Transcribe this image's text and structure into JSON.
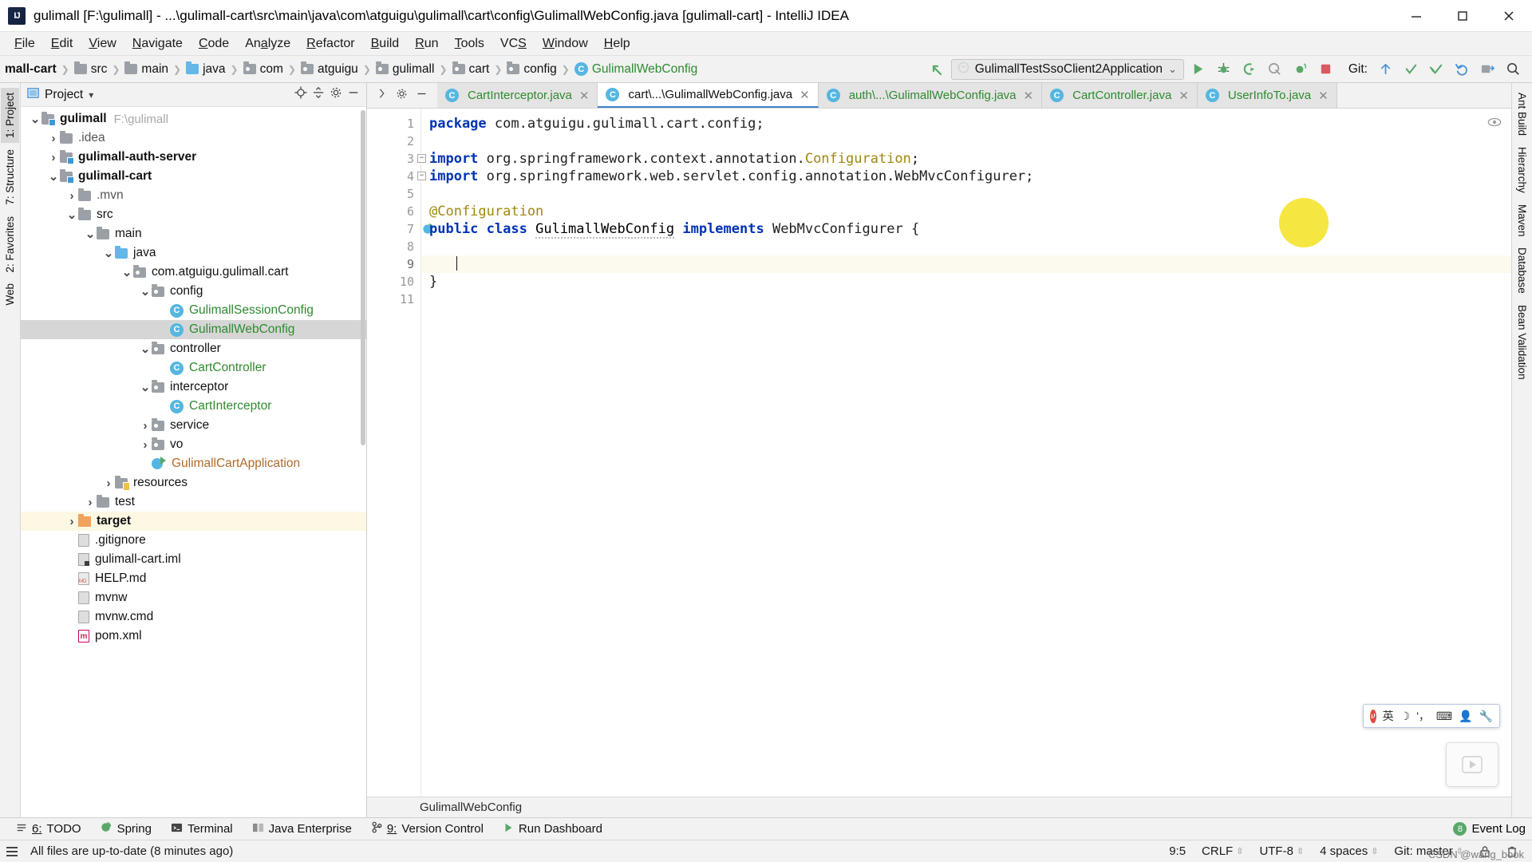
{
  "window": {
    "title": "gulimall [F:\\gulimall] - ...\\gulimall-cart\\src\\main\\java\\com\\atguigu\\gulimall\\cart\\config\\GulimallWebConfig.java [gulimall-cart] - IntelliJ IDEA",
    "logo_text": "IJ",
    "minimize": "–",
    "maximize": "□",
    "close": "✕"
  },
  "menubar": {
    "items": [
      {
        "pre": "",
        "mn": "F",
        "post": "ile"
      },
      {
        "pre": "",
        "mn": "E",
        "post": "dit"
      },
      {
        "pre": "",
        "mn": "V",
        "post": "iew"
      },
      {
        "pre": "",
        "mn": "N",
        "post": "avigate"
      },
      {
        "pre": "",
        "mn": "C",
        "post": "ode"
      },
      {
        "pre": "An",
        "mn": "a",
        "post": "lyze"
      },
      {
        "pre": "",
        "mn": "R",
        "post": "efactor"
      },
      {
        "pre": "",
        "mn": "B",
        "post": "uild"
      },
      {
        "pre": "",
        "mn": "R",
        "post": "un"
      },
      {
        "pre": "",
        "mn": "T",
        "post": "ools"
      },
      {
        "pre": "VC",
        "mn": "S",
        "post": ""
      },
      {
        "pre": "",
        "mn": "W",
        "post": "indow"
      },
      {
        "pre": "",
        "mn": "H",
        "post": "elp"
      }
    ]
  },
  "navbar": {
    "crumbs": [
      {
        "label": "mall-cart",
        "icon": "",
        "bold": true
      },
      {
        "label": "src",
        "icon": "folder-grey"
      },
      {
        "label": "main",
        "icon": "folder-grey"
      },
      {
        "label": "java",
        "icon": "folder-blue"
      },
      {
        "label": "com",
        "icon": "package"
      },
      {
        "label": "atguigu",
        "icon": "package"
      },
      {
        "label": "gulimall",
        "icon": "package"
      },
      {
        "label": "cart",
        "icon": "package"
      },
      {
        "label": "config",
        "icon": "package"
      },
      {
        "label": "GulimallWebConfig",
        "icon": "class",
        "is_class": true
      }
    ],
    "run_config": "GulimallTestSsoClient2Application",
    "run_config_caret": "⌄",
    "git_label": "Git:",
    "icons": [
      "back-arrow-icon",
      "run-icon",
      "debug-icon",
      "run-with-coverage-icon",
      "profiler-icon",
      "stop-icon",
      "update-project-icon",
      "commit-icon",
      "push-icon",
      "rollback-icon",
      "select-opened-file-icon",
      "search-everywhere-icon"
    ]
  },
  "editor_tabs": [
    {
      "label": "CartInterceptor.java",
      "active": false
    },
    {
      "label": "cart\\...\\GulimallWebConfig.java",
      "active": true
    },
    {
      "label": "auth\\...\\GulimallWebConfig.java",
      "active": false
    },
    {
      "label": "CartController.java",
      "active": false
    },
    {
      "label": "UserInfoTo.java",
      "active": false
    }
  ],
  "tool_window": {
    "title": "Project",
    "dropdown_caret": "▾",
    "icons": [
      "locate-icon",
      "collapse-all-icon",
      "settings-icon",
      "hide-icon"
    ]
  },
  "tree": [
    {
      "indent": 0,
      "arrow": "v",
      "icon": "module",
      "label": "gulimall",
      "bold": true,
      "path": "F:\\gulimall"
    },
    {
      "indent": 1,
      "arrow": ">",
      "icon": "folder-grey",
      "label": ".idea",
      "muted": true
    },
    {
      "indent": 1,
      "arrow": ">",
      "icon": "module",
      "label": "gulimall-auth-server",
      "bold": true
    },
    {
      "indent": 1,
      "arrow": "v",
      "icon": "module",
      "label": "gulimall-cart",
      "bold": true
    },
    {
      "indent": 2,
      "arrow": ">",
      "icon": "folder-grey",
      "label": ".mvn",
      "muted": true
    },
    {
      "indent": 2,
      "arrow": "v",
      "icon": "folder-grey",
      "label": "src"
    },
    {
      "indent": 3,
      "arrow": "v",
      "icon": "folder-grey",
      "label": "main"
    },
    {
      "indent": 4,
      "arrow": "v",
      "icon": "folder-blue",
      "label": "java"
    },
    {
      "indent": 5,
      "arrow": "v",
      "icon": "package",
      "label": "com.atguigu.gulimall.cart"
    },
    {
      "indent": 6,
      "arrow": "v",
      "icon": "package",
      "label": "config"
    },
    {
      "indent": 7,
      "arrow": "",
      "icon": "class",
      "label": "GulimallSessionConfig",
      "green": true
    },
    {
      "indent": 7,
      "arrow": "",
      "icon": "class",
      "label": "GulimallWebConfig",
      "green": true,
      "selected": true
    },
    {
      "indent": 6,
      "arrow": "v",
      "icon": "package",
      "label": "controller"
    },
    {
      "indent": 7,
      "arrow": "",
      "icon": "class",
      "label": "CartController",
      "green": true
    },
    {
      "indent": 6,
      "arrow": "v",
      "icon": "package",
      "label": "interceptor"
    },
    {
      "indent": 7,
      "arrow": "",
      "icon": "class",
      "label": "CartInterceptor",
      "green": true
    },
    {
      "indent": 6,
      "arrow": ">",
      "icon": "package",
      "label": "service"
    },
    {
      "indent": 6,
      "arrow": ">",
      "icon": "package",
      "label": "vo"
    },
    {
      "indent": 6,
      "arrow": "",
      "icon": "spring-run",
      "label": "GulimallCartApplication",
      "orange": true
    },
    {
      "indent": 4,
      "arrow": ">",
      "icon": "resources",
      "label": "resources"
    },
    {
      "indent": 3,
      "arrow": ">",
      "icon": "folder-grey",
      "label": "test"
    },
    {
      "indent": 2,
      "arrow": ">",
      "icon": "folder-orange",
      "label": "target",
      "bold": true,
      "highlight": true
    },
    {
      "indent": 2,
      "arrow": "",
      "icon": "file",
      "label": ".gitignore"
    },
    {
      "indent": 2,
      "arrow": "",
      "icon": "iml",
      "label": "gulimall-cart.iml"
    },
    {
      "indent": 2,
      "arrow": "",
      "icon": "file-md",
      "label": "HELP.md"
    },
    {
      "indent": 2,
      "arrow": "",
      "icon": "file",
      "label": "mvnw"
    },
    {
      "indent": 2,
      "arrow": "",
      "icon": "file",
      "label": "mvnw.cmd"
    },
    {
      "indent": 2,
      "arrow": "",
      "icon": "file-xml",
      "label": "pom.xml"
    }
  ],
  "code": {
    "lines": [
      {
        "n": 1,
        "segments": [
          {
            "t": "package",
            "c": "kw"
          },
          {
            "t": " com.atguigu.gulimall.cart.config;",
            "c": "plain"
          }
        ]
      },
      {
        "n": 2,
        "segments": []
      },
      {
        "n": 3,
        "fold": true,
        "segments": [
          {
            "t": "import",
            "c": "kw"
          },
          {
            "t": " org.springframework.context.annotation.",
            "c": "plain"
          },
          {
            "t": "Configuration",
            "c": "cfg"
          },
          {
            "t": ";",
            "c": "plain"
          }
        ]
      },
      {
        "n": 4,
        "fold": true,
        "segments": [
          {
            "t": "import",
            "c": "kw"
          },
          {
            "t": " org.springframework.web.servlet.config.annotation.WebMvcConfigurer;",
            "c": "plain"
          }
        ]
      },
      {
        "n": 5,
        "segments": []
      },
      {
        "n": 6,
        "segments": [
          {
            "t": "@Configuration",
            "c": "ann"
          }
        ]
      },
      {
        "n": 7,
        "bean": true,
        "segments": [
          {
            "t": "public",
            "c": "kw"
          },
          {
            "t": " ",
            "c": "plain"
          },
          {
            "t": "class",
            "c": "kw"
          },
          {
            "t": " ",
            "c": "plain"
          },
          {
            "t": "GulimallWebConfig",
            "c": "squiggle"
          },
          {
            "t": " ",
            "c": "plain"
          },
          {
            "t": "implements",
            "c": "kw"
          },
          {
            "t": " WebMvcConfigurer {",
            "c": "plain"
          }
        ]
      },
      {
        "n": 8,
        "segments": []
      },
      {
        "n": 9,
        "caret": true,
        "segments": []
      },
      {
        "n": 10,
        "segments": [
          {
            "t": "}",
            "c": "plain"
          }
        ]
      },
      {
        "n": 11,
        "segments": []
      }
    ],
    "breadcrumb_bottom": "GulimallWebConfig"
  },
  "left_rail": [
    {
      "label": "1: Project",
      "selected": true
    },
    {
      "label": "7: Structure",
      "selected": false
    },
    {
      "label": "2: Favorites",
      "selected": false
    },
    {
      "label": "Web",
      "selected": false
    }
  ],
  "right_rail": [
    {
      "label": "Ant Build"
    },
    {
      "label": "Hierarchy"
    },
    {
      "label": "Maven"
    },
    {
      "label": "Database"
    },
    {
      "label": "Bean Validation"
    }
  ],
  "bottom_tools": [
    {
      "num": "6",
      "label": "TODO",
      "icon": "todo-icon"
    },
    {
      "num": "",
      "label": "Spring",
      "icon": "spring-icon"
    },
    {
      "num": "",
      "label": "Terminal",
      "icon": "terminal-icon"
    },
    {
      "num": "",
      "label": "Java Enterprise",
      "icon": "java-ee-icon"
    },
    {
      "num": "9",
      "label": "Version Control",
      "icon": "version-control-icon"
    },
    {
      "num": "",
      "label": "Run Dashboard",
      "icon": "run-dashboard-icon"
    }
  ],
  "statusbar": {
    "message": "All files are up-to-date (8 minutes ago)",
    "caret_position": "9:5",
    "line_separator": "CRLF",
    "encoding": "UTF-8",
    "indent": "4 spaces",
    "git_branch": "Git: master",
    "event_log": "Event Log",
    "event_log_count": "8",
    "lock_icon": "🔒",
    "watermark": "CSDN @wang_book"
  }
}
